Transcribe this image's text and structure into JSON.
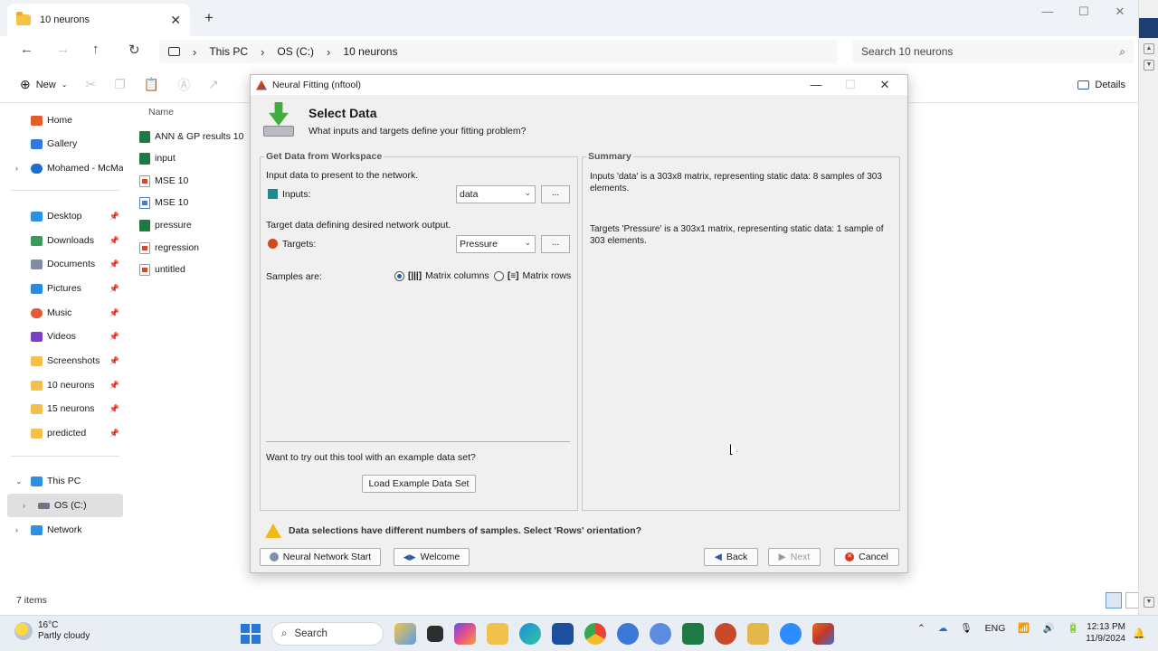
{
  "explorer": {
    "tab_title": "10 neurons",
    "breadcrumb": [
      "This PC",
      "OS (C:)",
      "10 neurons"
    ],
    "search_placeholder": "Search 10 neurons",
    "new_label": "New",
    "details_label": "Details",
    "column_name": "Name",
    "status": "7 items",
    "sidebar": {
      "home": "Home",
      "gallery": "Gallery",
      "onedrive": "Mohamed - McMaster",
      "desktop": "Desktop",
      "downloads": "Downloads",
      "documents": "Documents",
      "pictures": "Pictures",
      "music": "Music",
      "videos": "Videos",
      "screenshots": "Screenshots",
      "folder_10": "10 neurons",
      "folder_15": "15 neurons",
      "predicted": "predicted",
      "this_pc": "This PC",
      "os_c": "OS (C:)",
      "network": "Network"
    },
    "files": [
      {
        "name": "ANN & GP results 10",
        "type": "xls"
      },
      {
        "name": "input",
        "type": "xls"
      },
      {
        "name": "MSE 10",
        "type": "mat"
      },
      {
        "name": "MSE 10",
        "type": "fig"
      },
      {
        "name": "pressure",
        "type": "xls"
      },
      {
        "name": "regression",
        "type": "mat"
      },
      {
        "name": "untitled",
        "type": "mat"
      }
    ]
  },
  "dialog": {
    "window_title": "Neural Fitting (nftool)",
    "title": "Select Data",
    "subtitle": "What inputs and targets define your fitting problem?",
    "workspace_panel_title": "Get Data from Workspace",
    "input_desc": "Input data to present to the network.",
    "inputs_label": "Inputs:",
    "inputs_value": "data",
    "target_desc": "Target data defining desired network output.",
    "targets_label": "Targets:",
    "targets_value": "Pressure",
    "dots": "...",
    "samples_label": "Samples are:",
    "radio_columns": "Matrix columns",
    "radio_rows": "Matrix rows",
    "example_prompt": "Want to try out this tool with an example data set?",
    "load_example": "Load Example Data Set",
    "summary_title": "Summary",
    "summary_inputs": "Inputs 'data' is a 303x8 matrix, representing static data: 8 samples of 303 elements.",
    "summary_targets": "Targets 'Pressure' is a 303x1 matrix, representing static data: 1 sample of 303 elements.",
    "warning": "Data selections have different numbers of samples. Select 'Rows' orientation?",
    "btn_nn_start": "Neural Network Start",
    "btn_welcome": "Welcome",
    "btn_back": "Back",
    "btn_next": "Next",
    "btn_cancel": "Cancel"
  },
  "taskbar": {
    "temp": "16°C",
    "weather": "Partly cloudy",
    "search": "Search",
    "lang": "ENG",
    "time": "12:13 PM",
    "date": "11/9/2024"
  }
}
